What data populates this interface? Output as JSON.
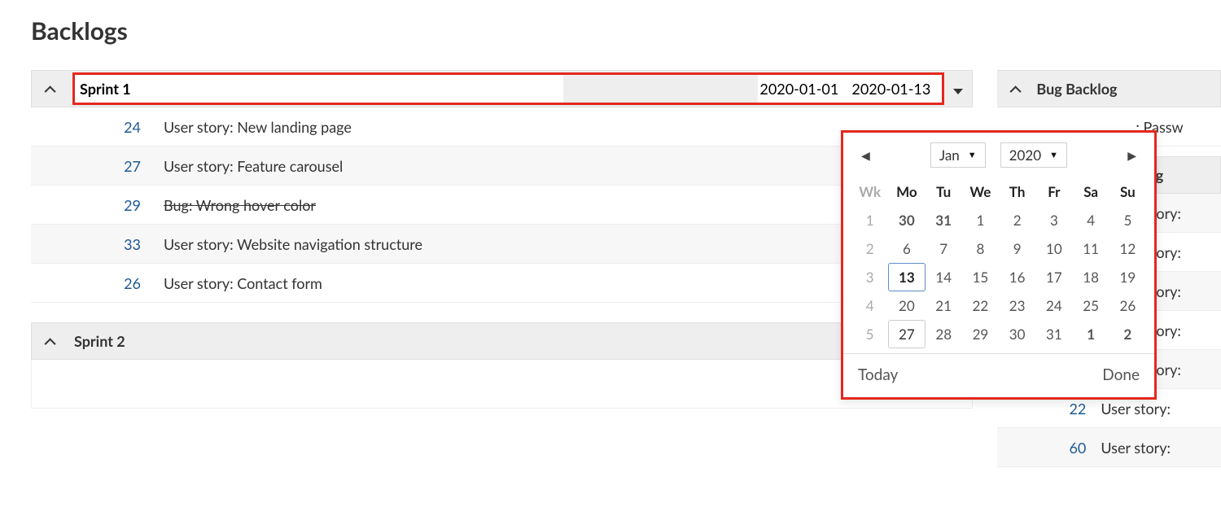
{
  "page": {
    "title": "Backlogs"
  },
  "sprint1": {
    "name": "Sprint 1",
    "start_date": "2020-01-01",
    "end_date": "2020-01-13",
    "items": [
      {
        "id": "24",
        "title": "User story: New landing page",
        "struck": false
      },
      {
        "id": "27",
        "title": "User story: Feature carousel",
        "struck": false
      },
      {
        "id": "29",
        "title": "Bug: Wrong hover color",
        "struck": true
      },
      {
        "id": "33",
        "title": "User story: Website navigation structure",
        "struck": false
      },
      {
        "id": "26",
        "title": "User story: Contact form",
        "struck": false
      }
    ]
  },
  "sprint2": {
    "name": "Sprint 2"
  },
  "right": {
    "bug_backlog": {
      "title": "Bug Backlog",
      "items": [
        {
          "title": ": Passw"
        }
      ]
    },
    "backlog": {
      "title": "klog",
      "items": [
        {
          "title": "r story:"
        },
        {
          "title": "r story:"
        },
        {
          "title": "r story:"
        },
        {
          "title": "r story:"
        },
        {
          "title": "r story:"
        },
        {
          "id": "22",
          "title": "User story:"
        },
        {
          "id": "60",
          "title": "User story:"
        }
      ]
    }
  },
  "datepicker": {
    "month": "Jan",
    "year": "2020",
    "dow_header": [
      "Wk",
      "Mo",
      "Tu",
      "We",
      "Th",
      "Fr",
      "Sa",
      "Su"
    ],
    "weeks": [
      {
        "wk": "1",
        "days": [
          {
            "d": "30",
            "other": true
          },
          {
            "d": "31",
            "other": true
          },
          {
            "d": "1"
          },
          {
            "d": "2"
          },
          {
            "d": "3"
          },
          {
            "d": "4"
          },
          {
            "d": "5"
          }
        ]
      },
      {
        "wk": "2",
        "days": [
          {
            "d": "6"
          },
          {
            "d": "7"
          },
          {
            "d": "8"
          },
          {
            "d": "9"
          },
          {
            "d": "10"
          },
          {
            "d": "11"
          },
          {
            "d": "12"
          }
        ]
      },
      {
        "wk": "3",
        "days": [
          {
            "d": "13",
            "selected": true
          },
          {
            "d": "14"
          },
          {
            "d": "15"
          },
          {
            "d": "16"
          },
          {
            "d": "17"
          },
          {
            "d": "18"
          },
          {
            "d": "19"
          }
        ]
      },
      {
        "wk": "4",
        "days": [
          {
            "d": "20"
          },
          {
            "d": "21"
          },
          {
            "d": "22"
          },
          {
            "d": "23"
          },
          {
            "d": "24"
          },
          {
            "d": "25"
          },
          {
            "d": "26"
          }
        ]
      },
      {
        "wk": "5",
        "days": [
          {
            "d": "27",
            "hover": true
          },
          {
            "d": "28"
          },
          {
            "d": "29"
          },
          {
            "d": "30"
          },
          {
            "d": "31"
          },
          {
            "d": "1",
            "other": true
          },
          {
            "d": "2",
            "other": true
          }
        ]
      }
    ],
    "today_label": "Today",
    "done_label": "Done"
  }
}
